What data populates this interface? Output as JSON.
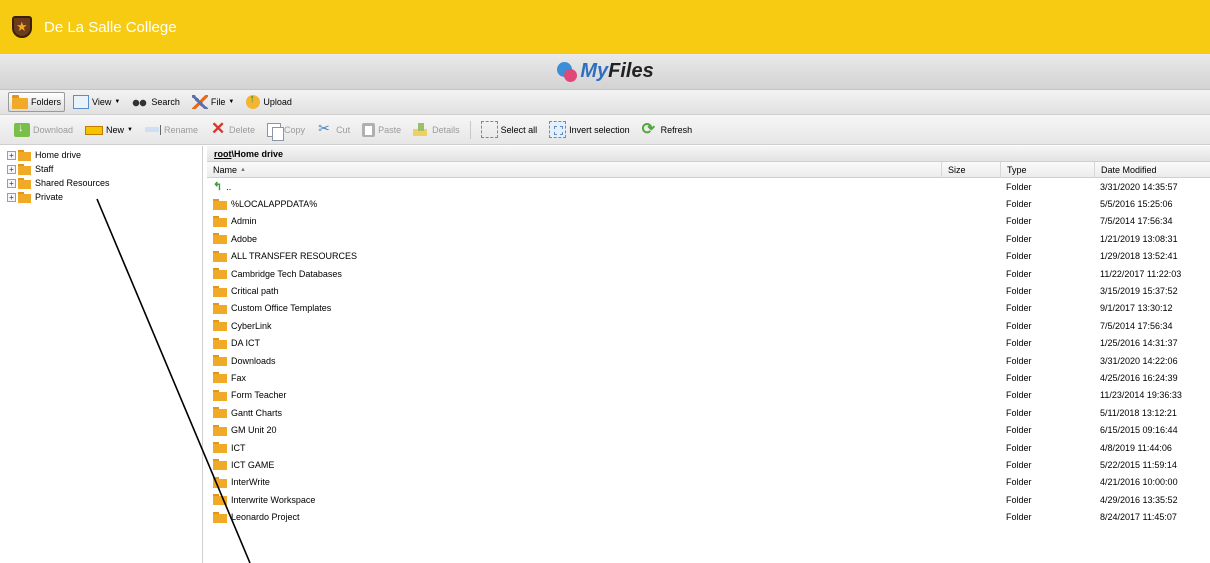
{
  "header": {
    "school_name": "De La Salle College",
    "brand_color": "#f8cb13"
  },
  "app": {
    "title_my": "My",
    "title_files": "Files"
  },
  "toolbar_top": {
    "folders": "Folders",
    "view": "View",
    "search": "Search",
    "file": "File",
    "upload": "Upload"
  },
  "toolbar_actions": {
    "download": "Download",
    "new": "New",
    "rename": "Rename",
    "delete": "Delete",
    "copy": "Copy",
    "cut": "Cut",
    "paste": "Paste",
    "details": "Details",
    "select_all": "Select all",
    "invert_selection": "Invert selection",
    "refresh": "Refresh"
  },
  "tree": {
    "items": [
      {
        "label": "Home drive"
      },
      {
        "label": "Staff"
      },
      {
        "label": "Shared Resources"
      },
      {
        "label": "Private"
      }
    ]
  },
  "path": {
    "root": "root",
    "separator": "\\",
    "current": "Home drive"
  },
  "columns": {
    "name": "Name",
    "size": "Size",
    "type": "Type",
    "date": "Date Modified"
  },
  "files": [
    {
      "name": "..",
      "type": "Folder",
      "date": "3/31/2020 14:35:57"
    },
    {
      "name": "%LOCALAPPDATA%",
      "type": "Folder",
      "date": "5/5/2016 15:25:06"
    },
    {
      "name": "Admin",
      "type": "Folder",
      "date": "7/5/2014 17:56:34"
    },
    {
      "name": "Adobe",
      "type": "Folder",
      "date": "1/21/2019 13:08:31"
    },
    {
      "name": "ALL TRANSFER RESOURCES",
      "type": "Folder",
      "date": "1/29/2018 13:52:41"
    },
    {
      "name": "Cambridge Tech Databases",
      "type": "Folder",
      "date": "11/22/2017 11:22:03"
    },
    {
      "name": "Critical path",
      "type": "Folder",
      "date": "3/15/2019 15:37:52"
    },
    {
      "name": "Custom Office Templates",
      "type": "Folder",
      "date": "9/1/2017 13:30:12"
    },
    {
      "name": "CyberLink",
      "type": "Folder",
      "date": "7/5/2014 17:56:34"
    },
    {
      "name": "DA ICT",
      "type": "Folder",
      "date": "1/25/2016 14:31:37"
    },
    {
      "name": "Downloads",
      "type": "Folder",
      "date": "3/31/2020 14:22:06"
    },
    {
      "name": "Fax",
      "type": "Folder",
      "date": "4/25/2016 16:24:39"
    },
    {
      "name": "Form Teacher",
      "type": "Folder",
      "date": "11/23/2014 19:36:33"
    },
    {
      "name": "Gantt Charts",
      "type": "Folder",
      "date": "5/11/2018 13:12:21"
    },
    {
      "name": "GM Unit 20",
      "type": "Folder",
      "date": "6/15/2015 09:16:44"
    },
    {
      "name": "ICT",
      "type": "Folder",
      "date": "4/8/2019 11:44:06"
    },
    {
      "name": "ICT GAME",
      "type": "Folder",
      "date": "5/22/2015 11:59:14"
    },
    {
      "name": "InterWrite",
      "type": "Folder",
      "date": "4/21/2016 10:00:00"
    },
    {
      "name": "Interwrite Workspace",
      "type": "Folder",
      "date": "4/29/2016 13:35:52"
    },
    {
      "name": "Leonardo Project",
      "type": "Folder",
      "date": "8/24/2017 11:45:07"
    }
  ]
}
